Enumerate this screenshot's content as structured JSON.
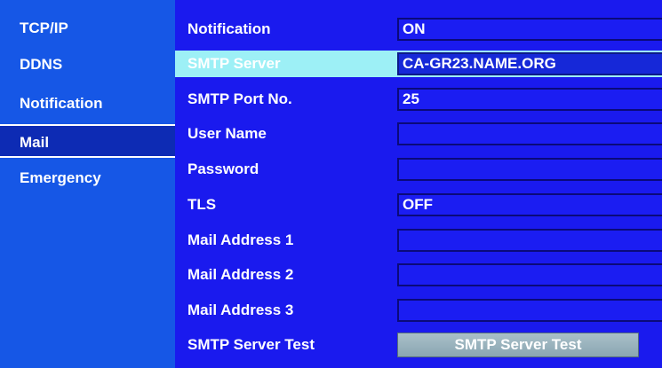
{
  "sidebar": {
    "items": [
      {
        "label": "TCP/IP"
      },
      {
        "label": "DDNS"
      },
      {
        "label": "Notification"
      },
      {
        "label": "Mail"
      },
      {
        "label": "Emergency"
      }
    ]
  },
  "form": {
    "notification": {
      "label": "Notification",
      "value": "ON"
    },
    "smtp_server": {
      "label": "SMTP Server",
      "value": "CA-GR23.NAME.ORG"
    },
    "smtp_port": {
      "label": "SMTP Port No.",
      "value": "25"
    },
    "user_name": {
      "label": "User Name",
      "value": ""
    },
    "password": {
      "label": "Password",
      "value": ""
    },
    "tls": {
      "label": "TLS",
      "value": "OFF"
    },
    "mail_address_1": {
      "label": "Mail Address 1",
      "value": ""
    },
    "mail_address_2": {
      "label": "Mail Address 2",
      "value": ""
    },
    "mail_address_3": {
      "label": "Mail Address 3",
      "value": ""
    },
    "smtp_server_test": {
      "label": "SMTP Server Test",
      "button_label": "SMTP Server Test"
    }
  },
  "colors": {
    "sidebar_bg": "#1657e6",
    "sidebar_active_bg": "#0d2bb4",
    "main_bg": "#1a1aee",
    "highlight_row": "#9df0f6",
    "button_bg": "#9ab3bd"
  }
}
